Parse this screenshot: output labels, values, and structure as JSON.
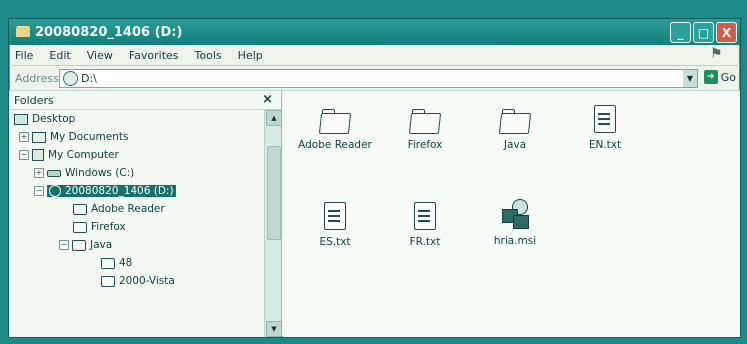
{
  "window": {
    "title": "20080820_1406 (D:)",
    "buttons": [
      "_",
      "□",
      "X"
    ]
  },
  "menu": [
    "File",
    "Edit",
    "View",
    "Favorites",
    "Tools",
    "Help"
  ],
  "address": {
    "label": "Address",
    "value": "D:\\",
    "go_label": "Go"
  },
  "folders": {
    "title": "Folders",
    "close": "×",
    "tree": [
      {
        "label": "Desktop"
      },
      {
        "label": "My Documents",
        "expander": "+"
      },
      {
        "label": "My Computer",
        "expander": "−"
      },
      {
        "label": "Windows (C:)",
        "expander": "+"
      },
      {
        "label": "20080820_1406 (D:)",
        "expander": "−",
        "selected": true
      },
      {
        "label": "Adobe Reader"
      },
      {
        "label": "Firefox"
      },
      {
        "label": "Java",
        "expander": "−"
      },
      {
        "label": "48"
      },
      {
        "label": "2000-Vista"
      }
    ]
  },
  "files": [
    {
      "name": "Adobe Reader",
      "icon": "folder-icon"
    },
    {
      "name": "Firefox",
      "icon": "folder-icon"
    },
    {
      "name": "Java",
      "icon": "folder-icon"
    },
    {
      "name": "EN.txt",
      "icon": "text-file-icon"
    },
    {
      "name": "ES.txt",
      "icon": "text-file-icon"
    },
    {
      "name": "FR.txt",
      "icon": "text-file-icon"
    },
    {
      "name": "hria.msi",
      "icon": "installer-icon"
    }
  ],
  "colors": {
    "desktop": "#1c8a86",
    "titlebar": "#157f7a",
    "selection": "#16706b"
  }
}
